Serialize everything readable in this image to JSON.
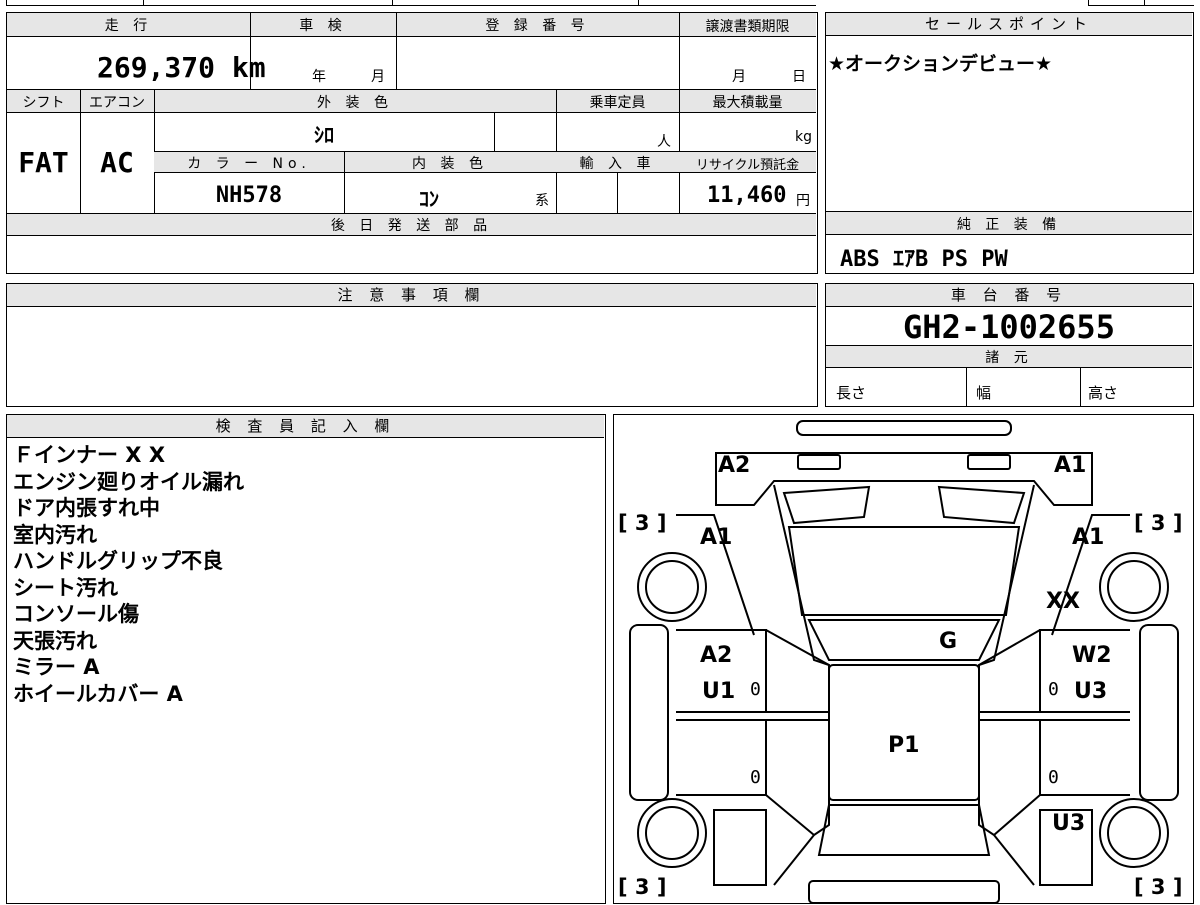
{
  "sheet": {
    "mileage": {
      "header": "走 行",
      "value": "269,370 km"
    },
    "inspection": {
      "header": "車 検",
      "year_label": "年",
      "month_label": "月"
    },
    "registration": {
      "header": "登 録 番 号",
      "value": ""
    },
    "transfer_deadline": {
      "header": "譲渡書類期限",
      "month_label": "月",
      "day_label": "日"
    },
    "shift": {
      "header": "シフト",
      "value": "FAT"
    },
    "aircon": {
      "header": "エアコン",
      "value": "AC"
    },
    "exterior_color": {
      "header": "外 装 色",
      "value": "ｼﾛ"
    },
    "capacity": {
      "header": "乗車定員",
      "unit": "人"
    },
    "max_load": {
      "header": "最大積載量",
      "unit": "kg"
    },
    "color_no": {
      "header": "カ ラ ー No.",
      "value": "NH578"
    },
    "interior_color": {
      "header": "内 装 色",
      "value": "ｺﾝ",
      "suffix": "系"
    },
    "import": {
      "header": "輸 入 車"
    },
    "recycle": {
      "header": "リサイクル預託金",
      "value": "11,460",
      "unit": "円"
    },
    "later_parts": {
      "header": "後 日 発 送 部 品"
    },
    "notes_header": "注 意 事 項 欄",
    "sales_point": {
      "header": "セールスポイント",
      "value": "★オークションデビュー★"
    },
    "equipment": {
      "header": "純 正 装 備",
      "value": "ABS ｴｱB PS PW"
    },
    "chassis": {
      "header": "車 台 番 号",
      "value": "GH2-1002655"
    },
    "specs": {
      "header": "諸 元",
      "length": "長さ",
      "width": "幅",
      "height": "高さ"
    }
  },
  "inspector": {
    "header": "検 査 員 記 入 欄",
    "lines": [
      "Ｆインナー X X",
      "エンジン廻りオイル漏れ",
      "ドア内張すれ中",
      "室内汚れ",
      "ハンドルグリップ不良",
      "シート汚れ",
      "コンソール傷",
      "天張汚れ",
      "ミラー A",
      "ホイールカバー A"
    ]
  },
  "diagram": {
    "marks": {
      "front_left": "A2",
      "front_right": "A1",
      "fender_left": "A1",
      "fender_right": "A1",
      "right_xx": "XX",
      "glass": "G",
      "door_left_1": "A2",
      "door_left_2": "U1",
      "door_right_1": "W2",
      "door_right_2": "U3",
      "roof": "P1",
      "rear_right": "U3"
    },
    "tire_labels": [
      "[ 3 ]",
      "[ 3 ]",
      "[ 3 ]",
      "[ 3 ]"
    ],
    "zeros": [
      "0",
      "0",
      "0",
      "0"
    ]
  }
}
